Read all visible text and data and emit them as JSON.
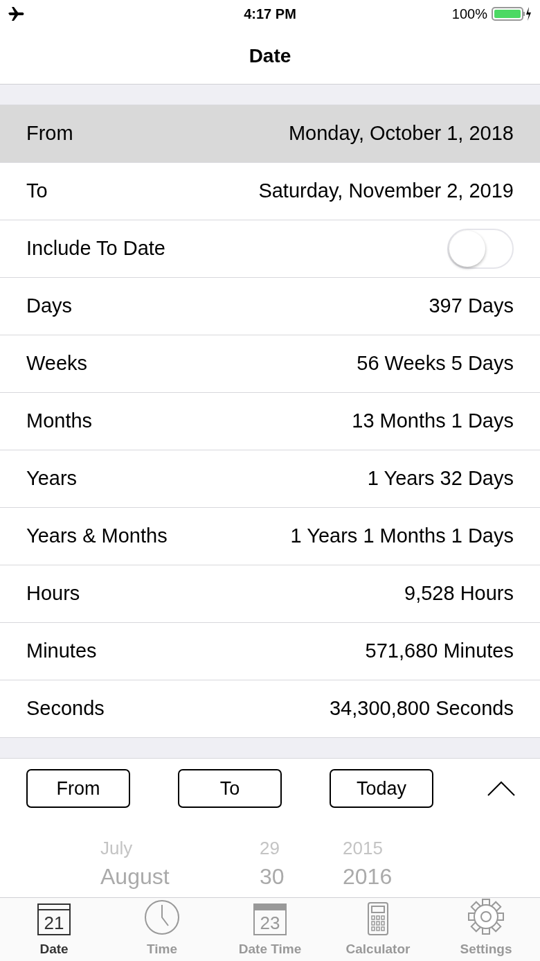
{
  "status_bar": {
    "time": "4:17 PM",
    "battery": "100%"
  },
  "nav": {
    "title": "Date"
  },
  "rows": [
    {
      "kind": "date",
      "label": "From",
      "value": "Monday, October 1, 2018",
      "selected": true
    },
    {
      "kind": "date",
      "label": "To",
      "value": "Saturday, November 2, 2019",
      "selected": false
    },
    {
      "kind": "toggle",
      "label": "Include To Date",
      "on": false
    },
    {
      "kind": "result",
      "label": "Days",
      "value": "397 Days"
    },
    {
      "kind": "result",
      "label": "Weeks",
      "value": "56 Weeks 5 Days"
    },
    {
      "kind": "result",
      "label": "Months",
      "value": "13 Months 1 Days"
    },
    {
      "kind": "result",
      "label": "Years",
      "value": "1 Years 32 Days"
    },
    {
      "kind": "result",
      "label": "Years & Months",
      "value": "1 Years 1 Months 1 Days"
    },
    {
      "kind": "result",
      "label": "Hours",
      "value": "9,528 Hours"
    },
    {
      "kind": "result",
      "label": "Minutes",
      "value": "571,680 Minutes"
    },
    {
      "kind": "result",
      "label": "Seconds",
      "value": "34,300,800 Seconds"
    }
  ],
  "buttons": [
    "From",
    "To",
    "Today"
  ],
  "picker": {
    "rows": [
      {
        "month": "July",
        "day": "29",
        "year": "2015"
      },
      {
        "month": "August",
        "day": "30",
        "year": "2016"
      }
    ]
  },
  "tab_bar": [
    {
      "kind": "calendar",
      "icon_text": "21",
      "label": "Date",
      "selected": true
    },
    {
      "kind": "clock",
      "label": "Time",
      "selected": false
    },
    {
      "kind": "calendar2",
      "icon_text": "23",
      "label": "Date Time",
      "selected": false
    },
    {
      "kind": "calculator",
      "label": "Calculator",
      "selected": false
    },
    {
      "kind": "gear",
      "label": "Settings",
      "selected": false
    }
  ]
}
